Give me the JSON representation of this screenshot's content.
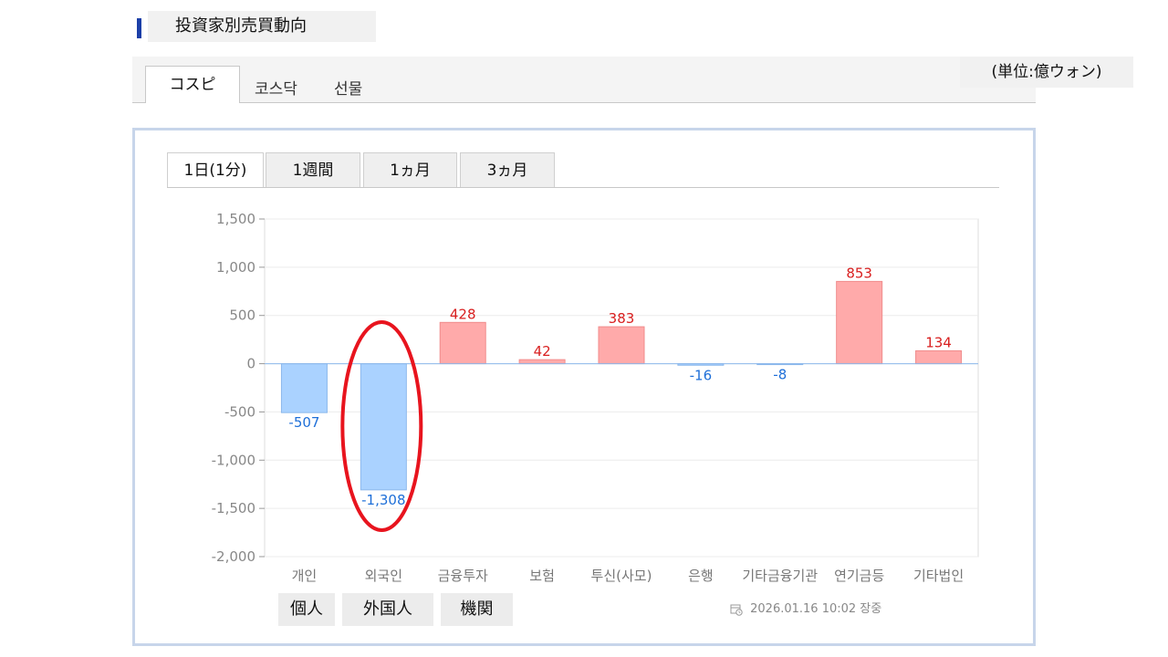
{
  "header": {
    "title": "投資家別売買動向"
  },
  "market_tabs": [
    {
      "label": "コスピ",
      "active": true
    },
    {
      "label": "코스닥",
      "active": false
    },
    {
      "label": "선물",
      "active": false
    }
  ],
  "unit_label": "(単位:億ウォン)",
  "period_tabs": [
    {
      "label": "1日(1分)",
      "active": true
    },
    {
      "label": "1週間",
      "active": false
    },
    {
      "label": "1ヵ月",
      "active": false
    },
    {
      "label": "3ヵ月",
      "active": false
    }
  ],
  "investor_buttons": [
    {
      "label": "個人"
    },
    {
      "label": "外国人"
    },
    {
      "label": "機関"
    }
  ],
  "timestamp": "2026.01.16 10:02 장중",
  "colors": {
    "positive_fill": "#ffaaaa",
    "positive_text": "#d81e1e",
    "negative_fill": "#aad2ff",
    "negative_text": "#1e6fd8",
    "highlight": "#e8141e",
    "frame": "#c7d5ea",
    "accent": "#1b3fa8"
  },
  "chart_data": {
    "type": "bar",
    "categories": [
      "개인",
      "외국인",
      "금융투자",
      "보험",
      "투신(사모)",
      "은행",
      "기타금융기관",
      "연기금등",
      "기타법인"
    ],
    "values": [
      -507,
      -1308,
      428,
      42,
      383,
      -16,
      -8,
      853,
      134
    ],
    "value_labels": [
      "-507",
      "-1,308",
      "428",
      "42",
      "383",
      "-16",
      "-8",
      "853",
      "134"
    ],
    "y_ticks": [
      "1,500",
      "1,000",
      "500",
      "0",
      "-500",
      "-1,000",
      "-1,500",
      "-2,000"
    ],
    "ylim": [
      -2000,
      1500
    ],
    "grid": true,
    "highlighted_category": "외국인"
  }
}
